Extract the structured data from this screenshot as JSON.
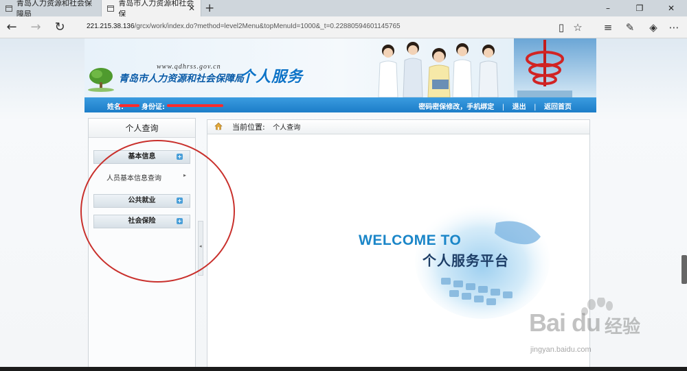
{
  "browser": {
    "tabs": [
      {
        "title": "青岛人力资源和社会保障局",
        "active": false
      },
      {
        "title": "青岛市人力资源和社会保",
        "active": true
      }
    ],
    "new_tab_label": "+",
    "url_host": "221.215.38.136",
    "url_path": "/grcx/work/index.do?method=level2Menu&topMenuId=1000&_t=0.22880594601145765",
    "window_controls": {
      "minimize": "–",
      "maximize": "❐",
      "close": "✕"
    },
    "icons": [
      "back-icon",
      "forward-icon",
      "refresh-icon",
      "reading-view-icon",
      "favorite-star-icon",
      "hub-icon",
      "web-note-icon",
      "share-icon",
      "more-icon"
    ]
  },
  "banner": {
    "site_url": "www.qdhrss.gov.cn",
    "site_name": "青岛市人力资源和社会保障局",
    "service_title": "个人服务"
  },
  "userbar": {
    "name_label": "姓名:",
    "id_label": "身份证:",
    "links": [
      "密码密保修改，手机绑定",
      "退出",
      "返回首页"
    ],
    "separator": "|"
  },
  "sidebar": {
    "title": "个人查询",
    "menus": [
      {
        "label": "基本信息",
        "items": [
          "人员基本信息查询"
        ]
      },
      {
        "label": "公共就业",
        "items": []
      },
      {
        "label": "社会保险",
        "items": []
      }
    ],
    "expand_symbol": "+",
    "item_arrow": "▸",
    "collapse_arrow": "◂"
  },
  "main": {
    "location_label": "当前位置:",
    "location_value": "个人查询",
    "welcome_en": "WELCOME TO",
    "welcome_cn": "个人服务平台"
  },
  "watermark": {
    "brand": "Bai du",
    "brand_cn": "经验",
    "url": "jingyan.baidu.com"
  },
  "colors": {
    "accent_blue": "#1c7dc8",
    "annotation_red": "#c9302c",
    "redaction_red": "#ff2b2b"
  }
}
